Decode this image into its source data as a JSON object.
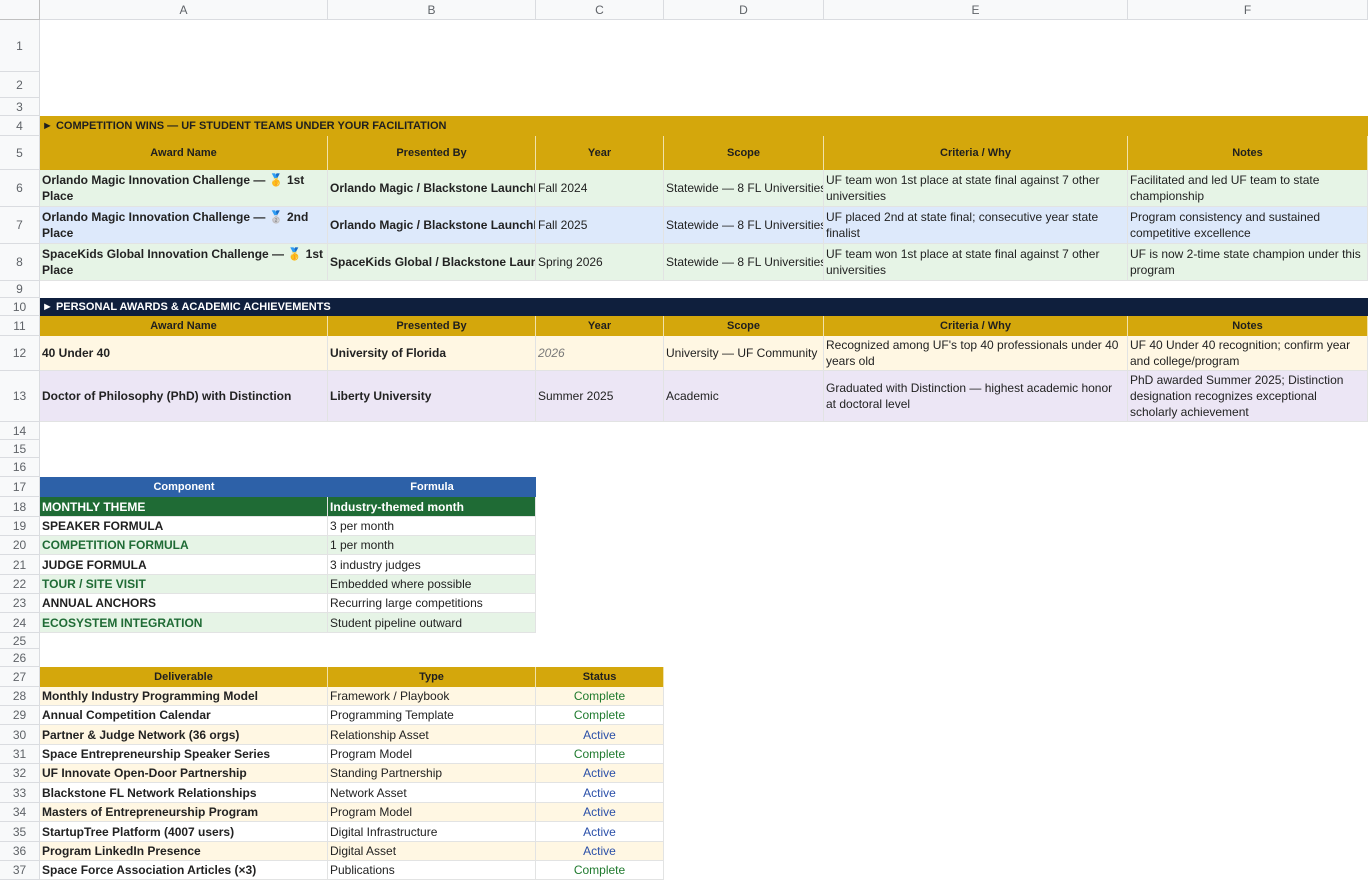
{
  "grid": {
    "columns": [
      "A",
      "B",
      "C",
      "D",
      "E",
      "F"
    ],
    "rows": [
      "1",
      "2",
      "3",
      "4",
      "5",
      "6",
      "7",
      "8",
      "9",
      "10",
      "11",
      "12",
      "13",
      "14",
      "15",
      "16",
      "17",
      "18",
      "19",
      "20",
      "21",
      "22",
      "23",
      "24",
      "25",
      "26",
      "27",
      "28",
      "29",
      "30",
      "31",
      "32",
      "33",
      "34",
      "35",
      "36",
      "37"
    ]
  },
  "competition": {
    "section_title": "► COMPETITION WINS — UF STUDENT TEAMS UNDER YOUR FACILITATION",
    "headers": [
      "Award Name",
      "Presented By",
      "Year",
      "Scope",
      "Criteria / Why",
      "Notes"
    ],
    "rows": [
      [
        "Orlando Magic Innovation Challenge — 🥇 1st Place",
        "Orlando Magic / Blackstone LaunchPad",
        "Fall 2024",
        "Statewide — 8 FL Universities",
        "UF team won 1st place at state final against 7 other universities",
        "Facilitated and led UF team to state championship"
      ],
      [
        "Orlando Magic Innovation Challenge — 🥈 2nd Place",
        "Orlando Magic / Blackstone LaunchPad",
        "Fall 2025",
        "Statewide — 8 FL Universities",
        "UF placed 2nd at state final; consecutive year state finalist",
        "Program consistency and sustained competitive excellence"
      ],
      [
        "SpaceKids Global Innovation Challenge — 🥇 1st Place",
        "SpaceKids Global / Blackstone LaunchPad",
        "Spring 2026",
        "Statewide — 8 FL Universities",
        "UF team won 1st place at state final against 7 other universities",
        "UF is now 2-time state champion under this program"
      ]
    ]
  },
  "personal": {
    "section_title": "► PERSONAL AWARDS & ACADEMIC ACHIEVEMENTS",
    "headers": [
      "Award Name",
      "Presented By",
      "Year",
      "Scope",
      "Criteria / Why",
      "Notes"
    ],
    "rows": [
      [
        "40 Under 40",
        "University of Florida",
        "2026",
        "University — UF Community",
        "Recognized among UF's top 40 professionals under 40 years old",
        "UF 40 Under 40 recognition; confirm year and college/program"
      ],
      [
        "Doctor of Philosophy (PhD) with Distinction",
        "Liberty University",
        "Summer 2025",
        "Academic",
        "Graduated with Distinction — highest academic honor at doctoral level",
        "PhD awarded Summer 2025; Distinction designation recognizes exceptional scholarly achievement"
      ]
    ]
  },
  "formula": {
    "headers": [
      "Component",
      "Formula"
    ],
    "rows": [
      [
        "MONTHLY THEME",
        "Industry-themed month"
      ],
      [
        "SPEAKER FORMULA",
        "3 per month"
      ],
      [
        "COMPETITION FORMULA",
        "1 per month"
      ],
      [
        "JUDGE FORMULA",
        "3 industry judges"
      ],
      [
        "TOUR / SITE VISIT",
        "Embedded where possible"
      ],
      [
        "ANNUAL ANCHORS",
        "Recurring large competitions"
      ],
      [
        "ECOSYSTEM INTEGRATION",
        "Student pipeline outward"
      ]
    ]
  },
  "deliverables": {
    "headers": [
      "Deliverable",
      "Type",
      "Status"
    ],
    "rows": [
      [
        "Monthly Industry Programming Model",
        "Framework / Playbook",
        "Complete"
      ],
      [
        "Annual Competition Calendar",
        "Programming Template",
        "Complete"
      ],
      [
        "Partner & Judge Network (36 orgs)",
        "Relationship Asset",
        "Active"
      ],
      [
        "Space Entrepreneurship Speaker Series",
        "Program Model",
        "Complete"
      ],
      [
        "UF Innovate Open-Door Partnership",
        "Standing Partnership",
        "Active"
      ],
      [
        "Blackstone FL Network Relationships",
        "Network Asset",
        "Active"
      ],
      [
        "Masters of Entrepreneurship Program",
        "Program Model",
        "Active"
      ],
      [
        "StartupTree Platform (4007 users)",
        "Digital Infrastructure",
        "Active"
      ],
      [
        "Program LinkedIn Presence",
        "Digital Asset",
        "Active"
      ],
      [
        "Space Force Association Articles (×3)",
        "Publications",
        "Complete"
      ]
    ]
  },
  "colors": {
    "gold": "#d4a70c",
    "navy": "#0f1f3d",
    "blue_header": "#2d61a8",
    "dark_green": "#1f6b35",
    "green_fill": "#e6f4e6",
    "blue_fill": "#dde9fb",
    "cream_fill": "#fff7e3",
    "lavender_fill": "#ece6f5"
  }
}
